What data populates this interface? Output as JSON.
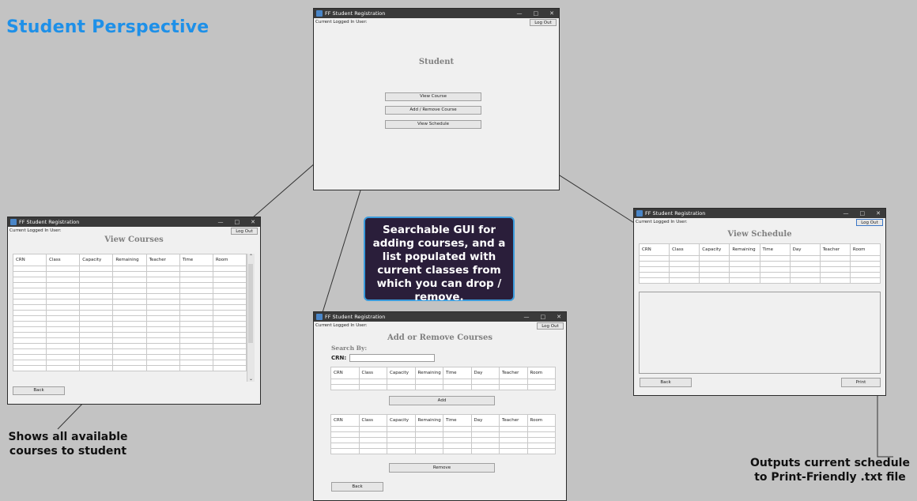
{
  "title": "Student Perspective",
  "window_title": "FF Student Registration",
  "user_label": "Current Logged In User:",
  "logout_label": "Log Out",
  "window_controls": {
    "minimize": "—",
    "maximize": "□",
    "close": "✕"
  },
  "student_window": {
    "heading": "Student",
    "buttons": [
      "View Course",
      "Add / Remove Course",
      "View Schedule"
    ]
  },
  "view_courses_window": {
    "heading": "View Courses",
    "columns": [
      "CRN",
      "Class",
      "Capacity",
      "Remaining",
      "Teacher",
      "Time",
      "Room"
    ],
    "back_label": "Back"
  },
  "add_remove_window": {
    "heading": "Add or Remove Courses",
    "search_by_label": "Search By:",
    "crn_label": "CRN:",
    "crn_value": "",
    "columns": [
      "CRN",
      "Class",
      "Capacity",
      "Remaining",
      "Time",
      "Day",
      "Teacher",
      "Room"
    ],
    "add_label": "Add",
    "remove_label": "Remove",
    "back_label": "Back"
  },
  "view_schedule_window": {
    "heading": "View Schedule",
    "columns": [
      "CRN",
      "Class",
      "Capacity",
      "Remaining",
      "Time",
      "Day",
      "Teacher",
      "Room"
    ],
    "back_label": "Back",
    "print_label": "Print"
  },
  "captions": {
    "view_courses": "Shows all available courses to student",
    "print": "Outputs current schedule to Print-Friendly .txt file",
    "add_remove": "Searchable GUI for adding courses, and a list populated with current classes from which you can drop / remove."
  },
  "colors": {
    "background": "#c3c3c3",
    "title_blue": "#1e90e8",
    "callout_bg": "#2a1e3a",
    "callout_border": "#3a9bdc",
    "titlebar": "#3a3a3a"
  }
}
